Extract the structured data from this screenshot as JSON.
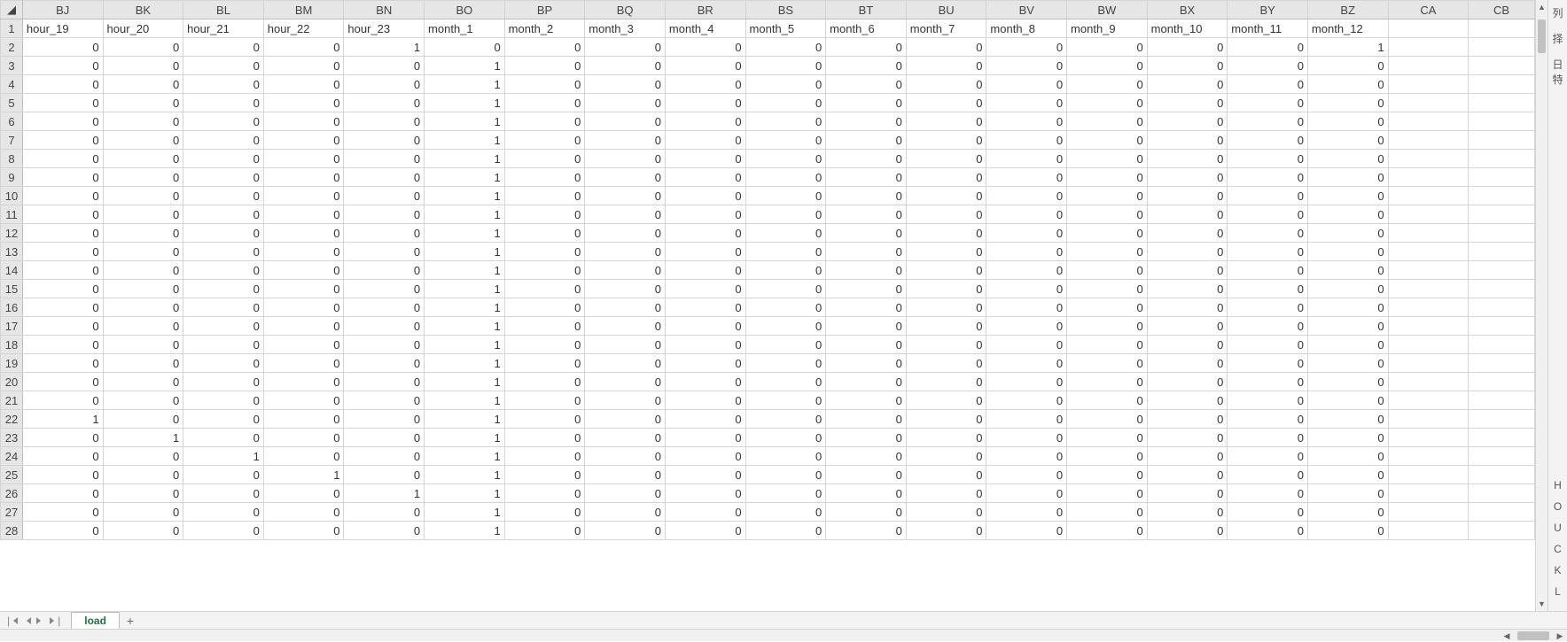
{
  "columns": [
    "BJ",
    "BK",
    "BL",
    "BM",
    "BN",
    "BO",
    "BP",
    "BQ",
    "BR",
    "BS",
    "BT",
    "BU",
    "BV",
    "BW",
    "BX",
    "BY",
    "BZ",
    "CA",
    "CB"
  ],
  "row_numbers": [
    1,
    2,
    3,
    4,
    5,
    6,
    7,
    8,
    9,
    10,
    11,
    12,
    13,
    14,
    15,
    16,
    17,
    18,
    19,
    20,
    21,
    22,
    23,
    24,
    25,
    26,
    27,
    28
  ],
  "headers": [
    "hour_19",
    "hour_20",
    "hour_21",
    "hour_22",
    "hour_23",
    "month_1",
    "month_2",
    "month_3",
    "month_4",
    "month_5",
    "month_6",
    "month_7",
    "month_8",
    "month_9",
    "month_10",
    "month_11",
    "month_12",
    "",
    ""
  ],
  "rows": [
    [
      0,
      0,
      0,
      0,
      1,
      0,
      0,
      0,
      0,
      0,
      0,
      0,
      0,
      0,
      0,
      0,
      1,
      "",
      ""
    ],
    [
      0,
      0,
      0,
      0,
      0,
      1,
      0,
      0,
      0,
      0,
      0,
      0,
      0,
      0,
      0,
      0,
      0,
      "",
      ""
    ],
    [
      0,
      0,
      0,
      0,
      0,
      1,
      0,
      0,
      0,
      0,
      0,
      0,
      0,
      0,
      0,
      0,
      0,
      "",
      ""
    ],
    [
      0,
      0,
      0,
      0,
      0,
      1,
      0,
      0,
      0,
      0,
      0,
      0,
      0,
      0,
      0,
      0,
      0,
      "",
      ""
    ],
    [
      0,
      0,
      0,
      0,
      0,
      1,
      0,
      0,
      0,
      0,
      0,
      0,
      0,
      0,
      0,
      0,
      0,
      "",
      ""
    ],
    [
      0,
      0,
      0,
      0,
      0,
      1,
      0,
      0,
      0,
      0,
      0,
      0,
      0,
      0,
      0,
      0,
      0,
      "",
      ""
    ],
    [
      0,
      0,
      0,
      0,
      0,
      1,
      0,
      0,
      0,
      0,
      0,
      0,
      0,
      0,
      0,
      0,
      0,
      "",
      ""
    ],
    [
      0,
      0,
      0,
      0,
      0,
      1,
      0,
      0,
      0,
      0,
      0,
      0,
      0,
      0,
      0,
      0,
      0,
      "",
      ""
    ],
    [
      0,
      0,
      0,
      0,
      0,
      1,
      0,
      0,
      0,
      0,
      0,
      0,
      0,
      0,
      0,
      0,
      0,
      "",
      ""
    ],
    [
      0,
      0,
      0,
      0,
      0,
      1,
      0,
      0,
      0,
      0,
      0,
      0,
      0,
      0,
      0,
      0,
      0,
      "",
      ""
    ],
    [
      0,
      0,
      0,
      0,
      0,
      1,
      0,
      0,
      0,
      0,
      0,
      0,
      0,
      0,
      0,
      0,
      0,
      "",
      ""
    ],
    [
      0,
      0,
      0,
      0,
      0,
      1,
      0,
      0,
      0,
      0,
      0,
      0,
      0,
      0,
      0,
      0,
      0,
      "",
      ""
    ],
    [
      0,
      0,
      0,
      0,
      0,
      1,
      0,
      0,
      0,
      0,
      0,
      0,
      0,
      0,
      0,
      0,
      0,
      "",
      ""
    ],
    [
      0,
      0,
      0,
      0,
      0,
      1,
      0,
      0,
      0,
      0,
      0,
      0,
      0,
      0,
      0,
      0,
      0,
      "",
      ""
    ],
    [
      0,
      0,
      0,
      0,
      0,
      1,
      0,
      0,
      0,
      0,
      0,
      0,
      0,
      0,
      0,
      0,
      0,
      "",
      ""
    ],
    [
      0,
      0,
      0,
      0,
      0,
      1,
      0,
      0,
      0,
      0,
      0,
      0,
      0,
      0,
      0,
      0,
      0,
      "",
      ""
    ],
    [
      0,
      0,
      0,
      0,
      0,
      1,
      0,
      0,
      0,
      0,
      0,
      0,
      0,
      0,
      0,
      0,
      0,
      "",
      ""
    ],
    [
      0,
      0,
      0,
      0,
      0,
      1,
      0,
      0,
      0,
      0,
      0,
      0,
      0,
      0,
      0,
      0,
      0,
      "",
      ""
    ],
    [
      0,
      0,
      0,
      0,
      0,
      1,
      0,
      0,
      0,
      0,
      0,
      0,
      0,
      0,
      0,
      0,
      0,
      "",
      ""
    ],
    [
      0,
      0,
      0,
      0,
      0,
      1,
      0,
      0,
      0,
      0,
      0,
      0,
      0,
      0,
      0,
      0,
      0,
      "",
      ""
    ],
    [
      1,
      0,
      0,
      0,
      0,
      1,
      0,
      0,
      0,
      0,
      0,
      0,
      0,
      0,
      0,
      0,
      0,
      "",
      ""
    ],
    [
      0,
      1,
      0,
      0,
      0,
      1,
      0,
      0,
      0,
      0,
      0,
      0,
      0,
      0,
      0,
      0,
      0,
      "",
      ""
    ],
    [
      0,
      0,
      1,
      0,
      0,
      1,
      0,
      0,
      0,
      0,
      0,
      0,
      0,
      0,
      0,
      0,
      0,
      "",
      ""
    ],
    [
      0,
      0,
      0,
      1,
      0,
      1,
      0,
      0,
      0,
      0,
      0,
      0,
      0,
      0,
      0,
      0,
      0,
      "",
      ""
    ],
    [
      0,
      0,
      0,
      0,
      1,
      1,
      0,
      0,
      0,
      0,
      0,
      0,
      0,
      0,
      0,
      0,
      0,
      "",
      ""
    ],
    [
      0,
      0,
      0,
      0,
      0,
      1,
      0,
      0,
      0,
      0,
      0,
      0,
      0,
      0,
      0,
      0,
      0,
      "",
      ""
    ],
    [
      0,
      0,
      0,
      0,
      0,
      1,
      0,
      0,
      0,
      0,
      0,
      0,
      0,
      0,
      0,
      0,
      0,
      "",
      ""
    ]
  ],
  "sheet_tab": "load",
  "side_labels": {
    "top1": "列",
    "top2": "择",
    "top3": "日特"
  },
  "side_letters": [
    "H",
    "O",
    "U",
    "C",
    "K",
    "L"
  ]
}
